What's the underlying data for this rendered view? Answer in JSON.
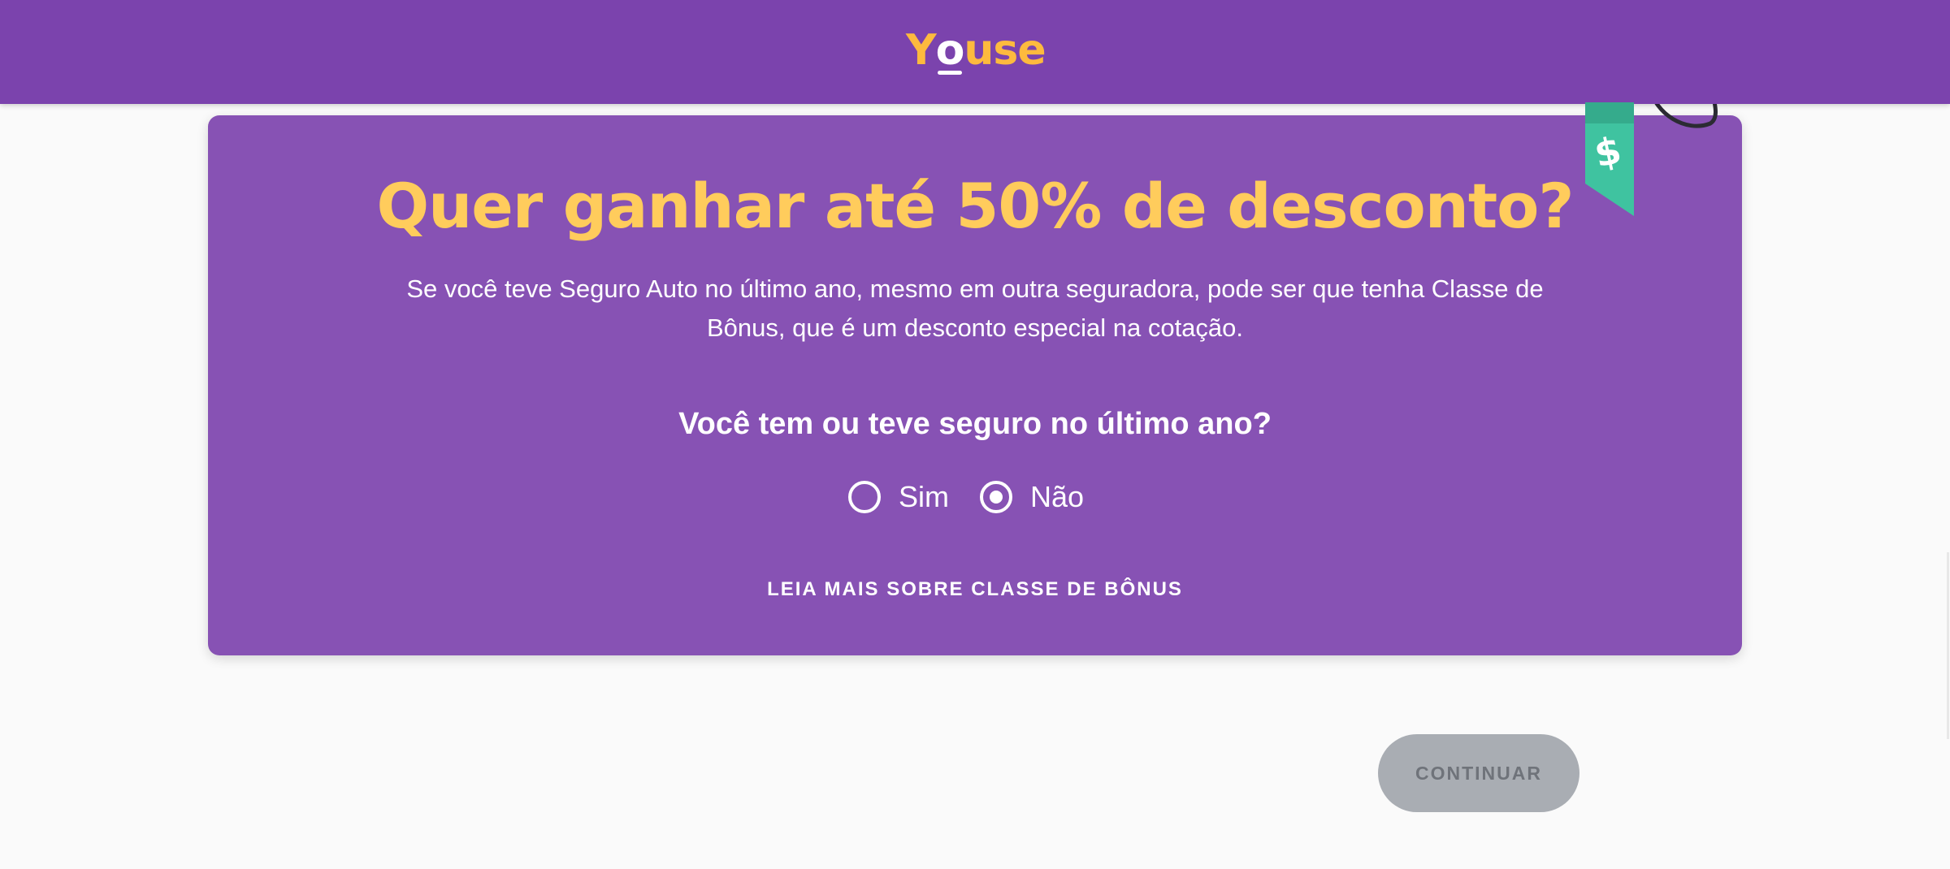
{
  "header": {
    "logo_text_before": "Y",
    "logo_text_o": "o",
    "logo_text_after": "use",
    "background_color": "#7b43ad",
    "logo_color": "#fdba3e"
  },
  "card": {
    "title": "Quer ganhar até 50% de desconto?",
    "description": "Se você teve Seguro Auto no último ano, mesmo em outra seguradora, pode ser que tenha Classe de Bônus, que é um desconto especial na cotação.",
    "question": "Você tem ou teve seguro no último ano?",
    "options": [
      {
        "label": "Sim",
        "selected": false
      },
      {
        "label": "Não",
        "selected": true
      }
    ],
    "read_more_label": "LEIA MAIS SOBRE CLASSE DE BÔNUS",
    "tag_icon": "dollar-price-tag-icon",
    "tag_symbol": "$",
    "background_color": "#8752b4",
    "title_color": "#ffcc5c"
  },
  "actions": {
    "continue_label": "CONTINUAR",
    "continue_enabled": false
  }
}
